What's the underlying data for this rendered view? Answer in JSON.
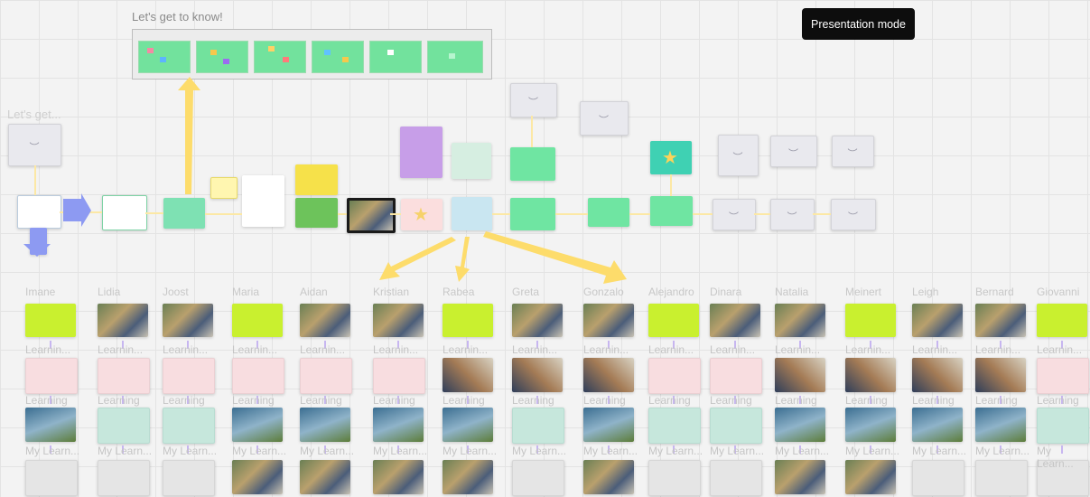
{
  "tooltip": {
    "label": "Presentation mode"
  },
  "frames": {
    "get_to_know_title": "Let's get to know!",
    "lets_get_title": "Let's get..."
  },
  "columns": [
    "Imane",
    "Lidia",
    "Joost",
    "Maria",
    "Aidan",
    "Kristian",
    "Rabea",
    "Greta",
    "Gonzalo",
    "Alejandro",
    "Dinara",
    "Natalia",
    "Meinert",
    "Leigh",
    "Bernard",
    "Giovanni"
  ],
  "row_labels": {
    "row2": "Learnin...",
    "row3": "Learning",
    "row4": "My Learn..."
  },
  "colors": {
    "accent_arrow": "#fddc6b",
    "board_bg": "#f3f3f3",
    "lime": "#c9f02f"
  },
  "icons": [
    "eye-closed-icon",
    "star-icon",
    "arrow-right-icon",
    "arrow-down-icon"
  ]
}
